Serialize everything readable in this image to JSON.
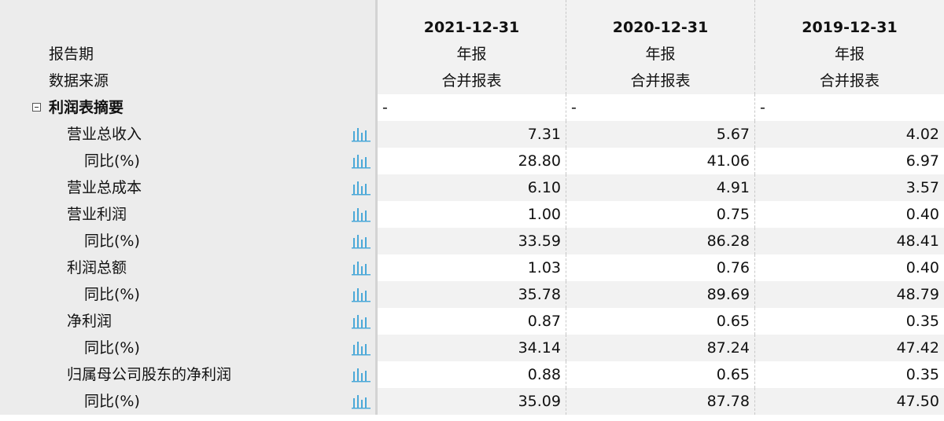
{
  "header": {
    "periods": [
      "2021-12-31",
      "2020-12-31",
      "2019-12-31"
    ]
  },
  "meta_rows": [
    {
      "label": "报告期",
      "values": [
        "年报",
        "年报",
        "年报"
      ]
    },
    {
      "label": "数据来源",
      "values": [
        "合并报表",
        "合并报表",
        "合并报表"
      ]
    }
  ],
  "section": {
    "label": "利润表摘要",
    "values": [
      "-",
      "-",
      "-"
    ]
  },
  "rows": [
    {
      "label": "营业总收入",
      "level": 1,
      "values": [
        "7.31",
        "5.67",
        "4.02"
      ]
    },
    {
      "label": "同比(%)",
      "level": 2,
      "values": [
        "28.80",
        "41.06",
        "6.97"
      ]
    },
    {
      "label": "营业总成本",
      "level": 1,
      "values": [
        "6.10",
        "4.91",
        "3.57"
      ]
    },
    {
      "label": "营业利润",
      "level": 1,
      "values": [
        "1.00",
        "0.75",
        "0.40"
      ]
    },
    {
      "label": "同比(%)",
      "level": 2,
      "values": [
        "33.59",
        "86.28",
        "48.41"
      ]
    },
    {
      "label": "利润总额",
      "level": 1,
      "values": [
        "1.03",
        "0.76",
        "0.40"
      ]
    },
    {
      "label": "同比(%)",
      "level": 2,
      "values": [
        "35.78",
        "89.69",
        "48.79"
      ]
    },
    {
      "label": "净利润",
      "level": 1,
      "values": [
        "0.87",
        "0.65",
        "0.35"
      ]
    },
    {
      "label": "同比(%)",
      "level": 2,
      "values": [
        "34.14",
        "87.24",
        "47.42"
      ]
    },
    {
      "label": "归属母公司股东的净利润",
      "level": 1,
      "values": [
        "0.88",
        "0.65",
        "0.35"
      ]
    },
    {
      "label": "同比(%)",
      "level": 2,
      "values": [
        "35.09",
        "87.78",
        "47.50"
      ]
    }
  ],
  "colors": {
    "chart_icon": "#4aa8d8"
  },
  "icons": {
    "row_chart": "bar-chart-icon",
    "section_toggle": "collapse-minus-icon"
  }
}
